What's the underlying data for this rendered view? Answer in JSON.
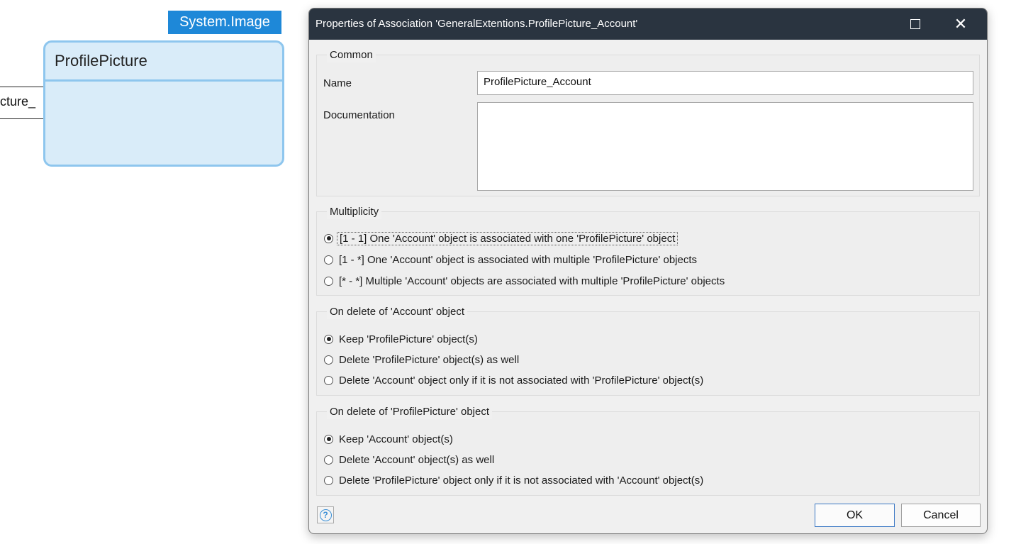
{
  "canvas": {
    "generalization_label": "System.Image",
    "entity_name": "ProfilePicture",
    "association_label": "cture_"
  },
  "dialog": {
    "title": "Properties of Association 'GeneralExtentions.ProfilePicture_Account'",
    "common": {
      "legend": "Common",
      "name_label": "Name",
      "name_value": "ProfilePicture_Account",
      "documentation_label": "Documentation",
      "documentation_value": ""
    },
    "multiplicity": {
      "legend": "Multiplicity",
      "options": [
        {
          "label": "[1 - 1] One 'Account' object is associated with one 'ProfilePicture' object",
          "checked": true
        },
        {
          "label": "[1 - *] One 'Account' object is associated with multiple 'ProfilePicture' objects",
          "checked": false
        },
        {
          "label": "[* - *] Multiple 'Account' objects are associated with multiple 'ProfilePicture' objects",
          "checked": false
        }
      ]
    },
    "delete_account": {
      "legend": "On delete of 'Account' object",
      "options": [
        {
          "label": "Keep 'ProfilePicture' object(s)",
          "checked": true
        },
        {
          "label": "Delete 'ProfilePicture' object(s) as well",
          "checked": false
        },
        {
          "label": "Delete 'Account' object only if it is not associated with 'ProfilePicture' object(s)",
          "checked": false
        }
      ]
    },
    "delete_profile": {
      "legend": "On delete of 'ProfilePicture' object",
      "options": [
        {
          "label": "Keep 'Account' object(s)",
          "checked": true
        },
        {
          "label": "Delete 'Account' object(s) as well",
          "checked": false
        },
        {
          "label": "Delete 'ProfilePicture' object only if it is not associated with 'Account' object(s)",
          "checked": false
        }
      ]
    },
    "buttons": {
      "help_glyph": "?",
      "ok": "OK",
      "cancel": "Cancel",
      "close_glyph": "✕"
    }
  }
}
